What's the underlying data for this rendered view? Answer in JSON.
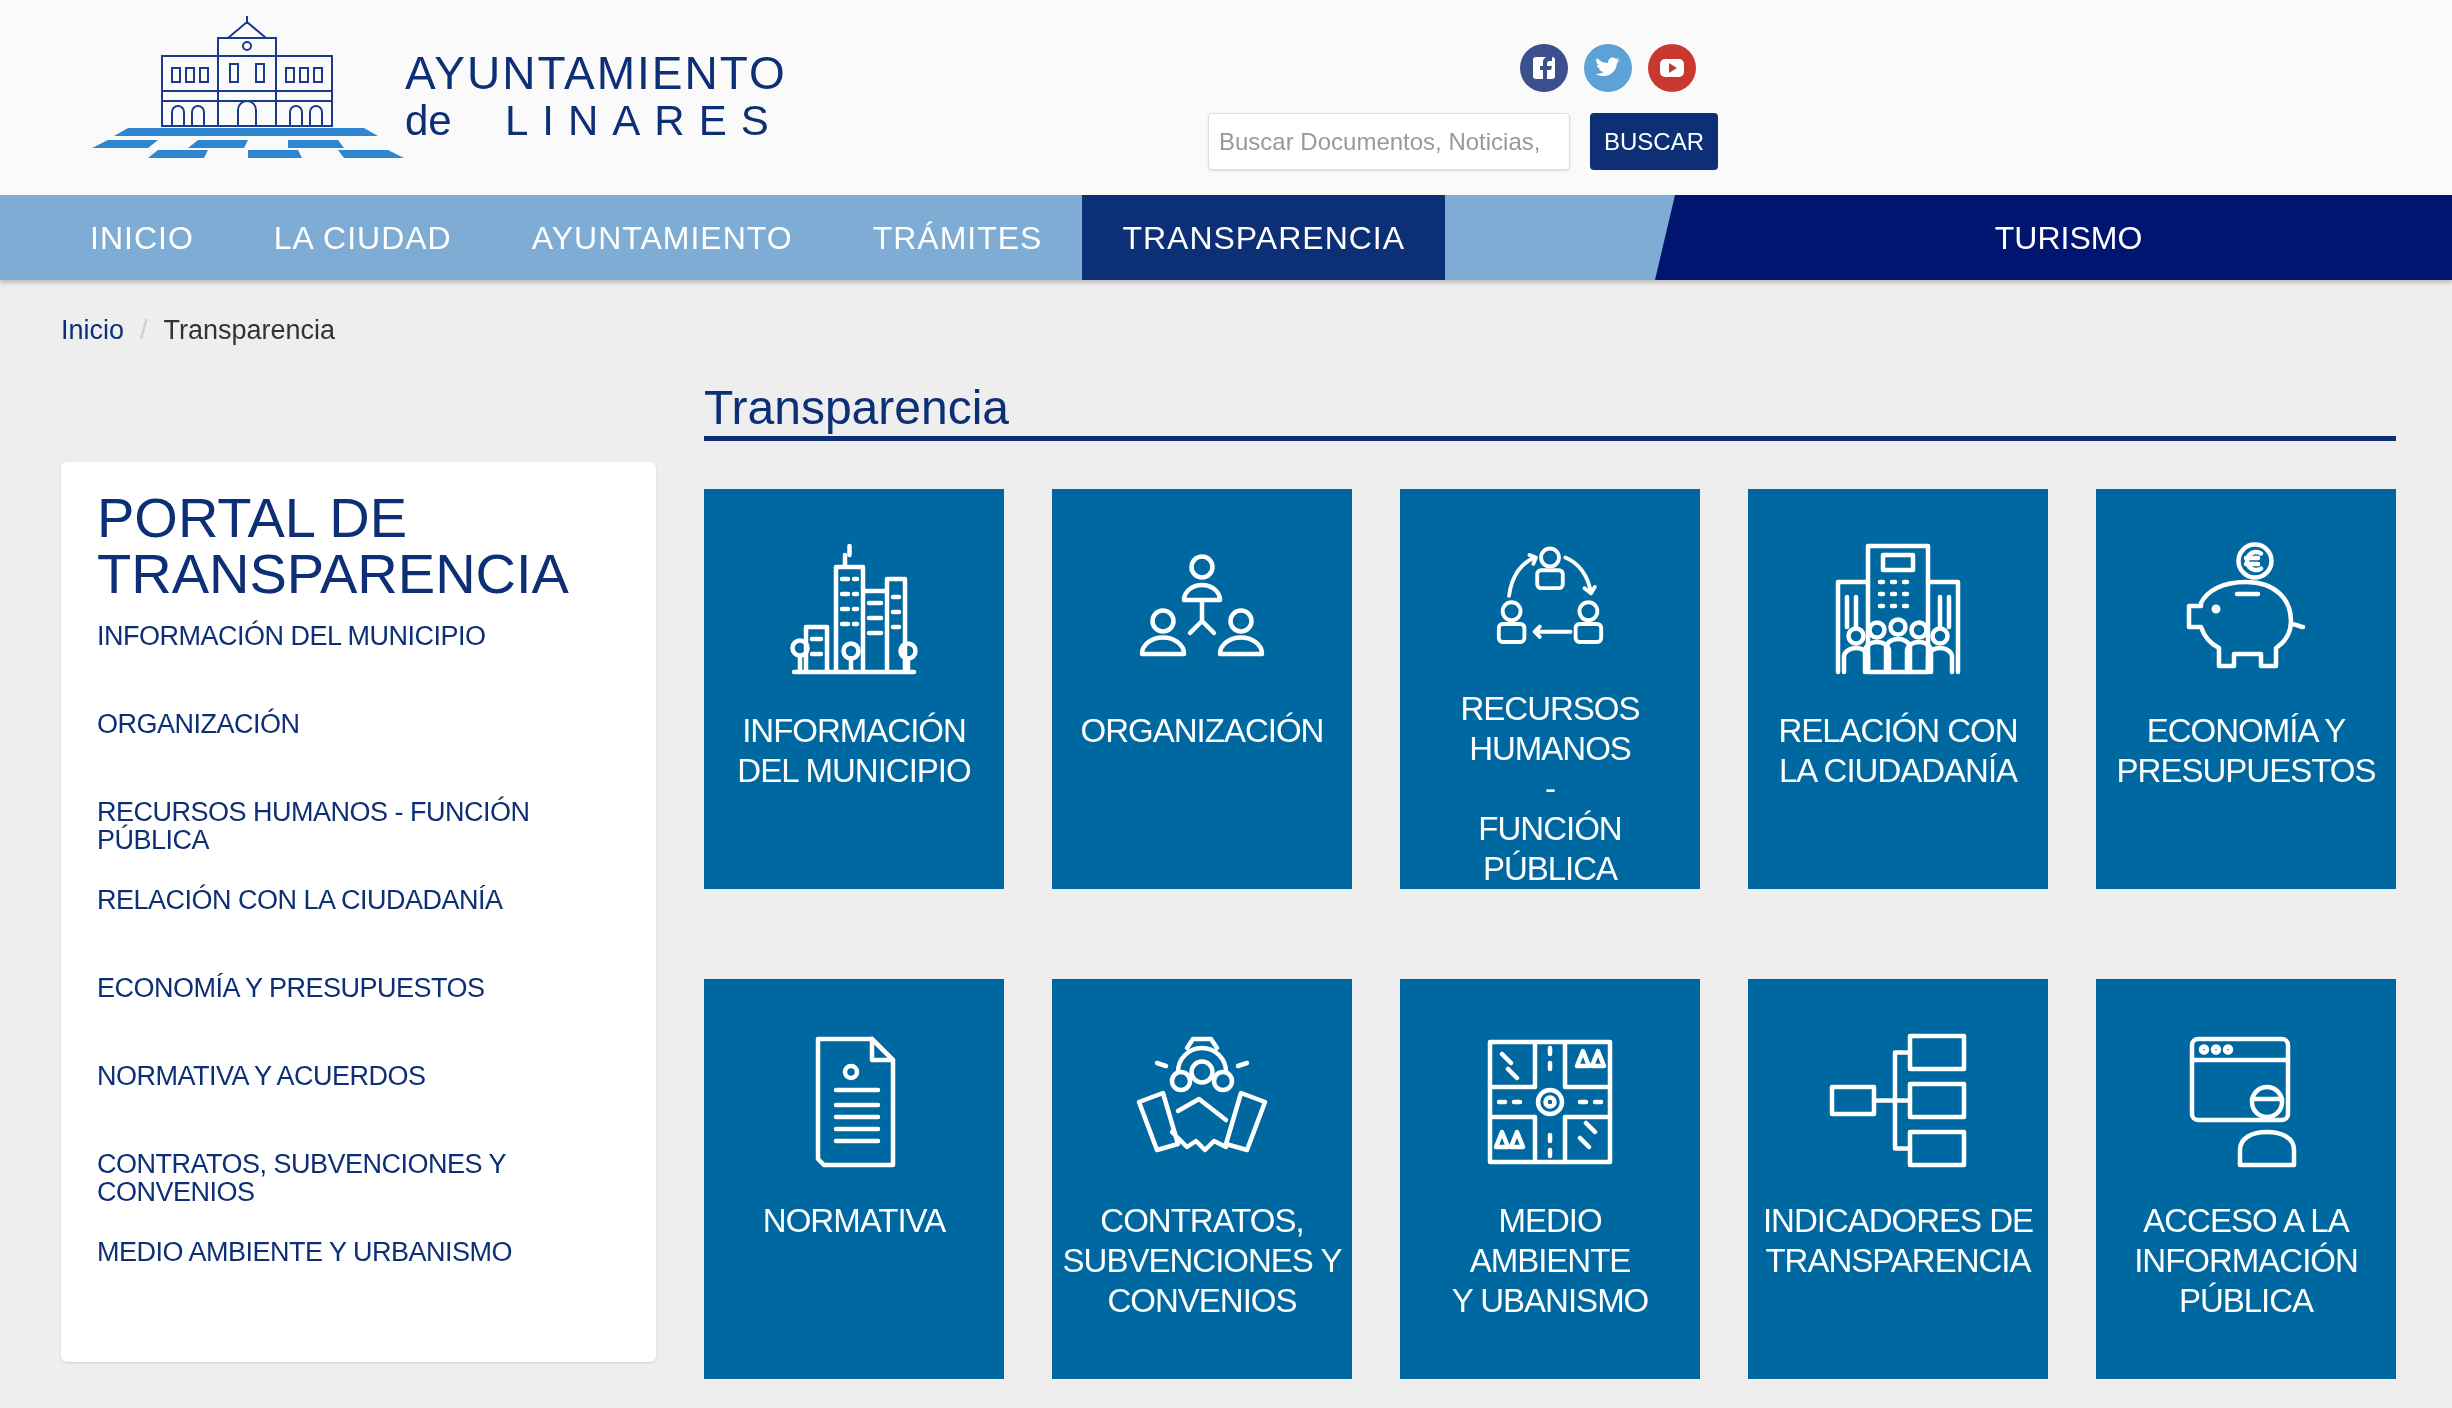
{
  "header": {
    "logo": {
      "line1": "AYUNTAMIENTO",
      "line2_a": "de",
      "line2_b": "LINARES"
    },
    "search": {
      "placeholder": "Buscar Documentos, Noticias,",
      "button": "BUSCAR"
    }
  },
  "nav": {
    "items": [
      {
        "label": "INICIO",
        "selected": false
      },
      {
        "label": "LA CIUDAD",
        "selected": false
      },
      {
        "label": "AYUNTAMIENTO",
        "selected": false
      },
      {
        "label": "TRÁMITES",
        "selected": false
      },
      {
        "label": "TRANSPARENCIA",
        "selected": true
      }
    ],
    "featured": "TURISMO"
  },
  "breadcrumb": {
    "items": [
      "Inicio",
      "Transparencia"
    ],
    "separator": "/"
  },
  "page_title": "Transparencia",
  "sidebar": {
    "title": "PORTAL DE TRANSPARENCIA",
    "items": [
      "INFORMACIÓN DEL MUNICIPIO",
      "ORGANIZACIÓN",
      "RECURSOS HUMANOS - FUNCIÓN PÚBLICA",
      "RELACIÓN CON LA CIUDADANÍA",
      "ECONOMÍA Y PRESUPUESTOS",
      "NORMATIVA Y ACUERDOS",
      "CONTRATOS, SUBVENCIONES Y CONVENIOS",
      "MEDIO AMBIENTE Y URBANISMO"
    ]
  },
  "tiles": [
    {
      "lines": [
        "INFORMACIÓN",
        "DEL MUNICIPIO"
      ]
    },
    {
      "lines": [
        "ORGANIZACIÓN"
      ]
    },
    {
      "lines": [
        "RECURSOS",
        "HUMANOS",
        "-",
        "FUNCIÓN",
        "PÚBLICA"
      ]
    },
    {
      "lines": [
        "RELACIÓN CON",
        "LA CIUDADANÍA"
      ]
    },
    {
      "lines": [
        "ECONOMÍA Y",
        "PRESUPUESTOS"
      ]
    },
    {
      "lines": [
        "NORMATIVA"
      ]
    },
    {
      "lines": [
        "CONTRATOS,",
        "SUBVENCIONES Y",
        "CONVENIOS"
      ]
    },
    {
      "lines": [
        "MEDIO",
        "AMBIENTE",
        "Y UBANISMO"
      ]
    },
    {
      "lines": [
        "INDICADORES DE",
        "TRANSPARENCIA"
      ]
    },
    {
      "lines": [
        "ACCESO A LA",
        "INFORMACIÓN",
        "PÚBLICA"
      ]
    }
  ]
}
